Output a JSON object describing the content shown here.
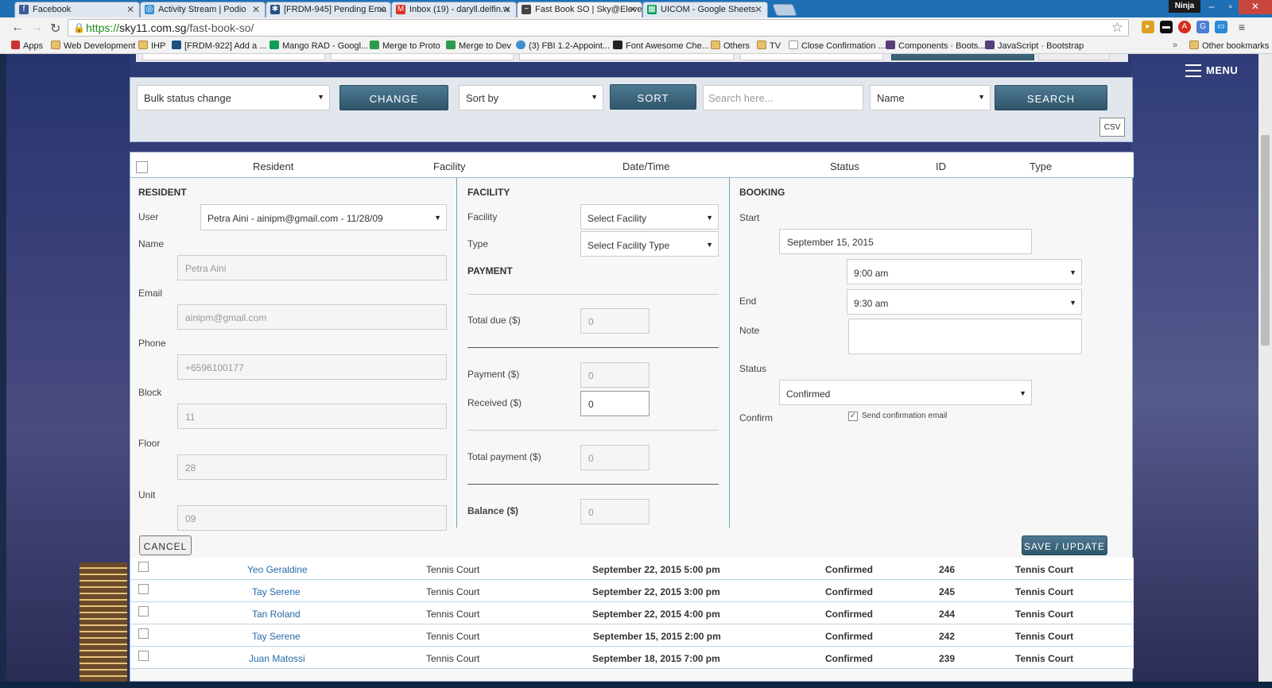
{
  "tabs": [
    {
      "label": "Facebook",
      "icon": "facebook-icon",
      "color": "#3b5998"
    },
    {
      "label": "Activity Stream | Podio",
      "icon": "podio-icon",
      "color": "#3e8ed0"
    },
    {
      "label": "[FRDM-945] Pending Ema",
      "icon": "jira-icon",
      "color": "#205081"
    },
    {
      "label": "Inbox (19) - daryll.delfin.w",
      "icon": "gmail-icon",
      "color": "#d93025"
    },
    {
      "label": "Fast Book SO | Sky@Eleve",
      "icon": "sky-icon",
      "color": "#444444"
    },
    {
      "label": "UICOM - Google Sheets",
      "icon": "sheets-icon",
      "color": "#0f9d58"
    }
  ],
  "window": {
    "user": "Ninja"
  },
  "address": {
    "protocol": "https://",
    "host": "sky11.com.sg",
    "path": "/fast-book-so/"
  },
  "bookmarks": [
    {
      "label": "Apps"
    },
    {
      "label": "Web Development"
    },
    {
      "label": "IHP"
    },
    {
      "label": "[FRDM-922] Add a ..."
    },
    {
      "label": "Mango RAD - Googl..."
    },
    {
      "label": "Merge to Proto"
    },
    {
      "label": "Merge to Dev"
    },
    {
      "label": "(3) FBI 1.2-Appoint..."
    },
    {
      "label": "Font Awesome Che..."
    },
    {
      "label": "Others"
    },
    {
      "label": "TV"
    },
    {
      "label": "Close Confirmation ..."
    },
    {
      "label": "Components · Boots..."
    },
    {
      "label": "JavaScript · Bootstrap"
    },
    {
      "label": "Other bookmarks"
    }
  ],
  "menu_label": "MENU",
  "toolbar": {
    "bulk_status": "Bulk status change",
    "change_label": "CHANGE",
    "sort_by": "Sort by",
    "sort_label": "SORT",
    "search_placeholder": "Search here...",
    "search_field": "Name",
    "search_label": "SEARCH",
    "csv_label": "CSV"
  },
  "table": {
    "headers": [
      "Resident",
      "Facility",
      "Date/Time",
      "Status",
      "ID",
      "Type"
    ],
    "rows": [
      {
        "resident": "Yeo Geraldine",
        "facility": "Tennis Court",
        "datetime": "September 22, 2015 5:00 pm",
        "status": "Confirmed",
        "id": "246",
        "type": "Tennis Court"
      },
      {
        "resident": "Tay Serene",
        "facility": "Tennis Court",
        "datetime": "September 22, 2015 3:00 pm",
        "status": "Confirmed",
        "id": "245",
        "type": "Tennis Court"
      },
      {
        "resident": "Tan Roland",
        "facility": "Tennis Court",
        "datetime": "September 22, 2015 4:00 pm",
        "status": "Confirmed",
        "id": "244",
        "type": "Tennis Court"
      },
      {
        "resident": "Tay Serene",
        "facility": "Tennis Court",
        "datetime": "September 15, 2015 2:00 pm",
        "status": "Confirmed",
        "id": "242",
        "type": "Tennis Court"
      },
      {
        "resident": "Juan Matossi",
        "facility": "Tennis Court",
        "datetime": "September 18, 2015 7:00 pm",
        "status": "Confirmed",
        "id": "239",
        "type": "Tennis Court"
      }
    ]
  },
  "resident": {
    "title": "RESIDENT",
    "user_label": "User",
    "user_value": "Petra Aini - ainipm@gmail.com - 11/28/09",
    "name_label": "Name",
    "name_placeholder": "Petra Aini",
    "email_label": "Email",
    "email_placeholder": "ainipm@gmail.com",
    "phone_label": "Phone",
    "phone_placeholder": "+6596100177",
    "block_label": "Block",
    "block_placeholder": "11",
    "floor_label": "Floor",
    "floor_placeholder": "28",
    "unit_label": "Unit",
    "unit_placeholder": "09"
  },
  "facility": {
    "title": "FACILITY",
    "facility_label": "Facility",
    "facility_value": "Select Facility",
    "type_label": "Type",
    "type_value": "Select Facility Type"
  },
  "payment": {
    "title": "PAYMENT",
    "total_due_label": "Total due ($)",
    "total_due": "0",
    "payment_label": "Payment ($)",
    "payment": "0",
    "received_label": "Received ($)",
    "received": "0",
    "total_payment_label": "Total payment ($)",
    "total_payment": "0",
    "balance_label": "Balance ($)",
    "balance": "0"
  },
  "booking": {
    "title": "BOOKING",
    "start_label": "Start",
    "start_date": "September 15, 2015",
    "start_time": "9:00 am",
    "end_label": "End",
    "end_time": "9:30 am",
    "note_label": "Note",
    "status_label": "Status",
    "status_value": "Confirmed",
    "confirm_label": "Confirm",
    "send_email_label": "Send confirmation email"
  },
  "actions": {
    "cancel": "CANCEL",
    "save": "SAVE / UPDATE"
  }
}
